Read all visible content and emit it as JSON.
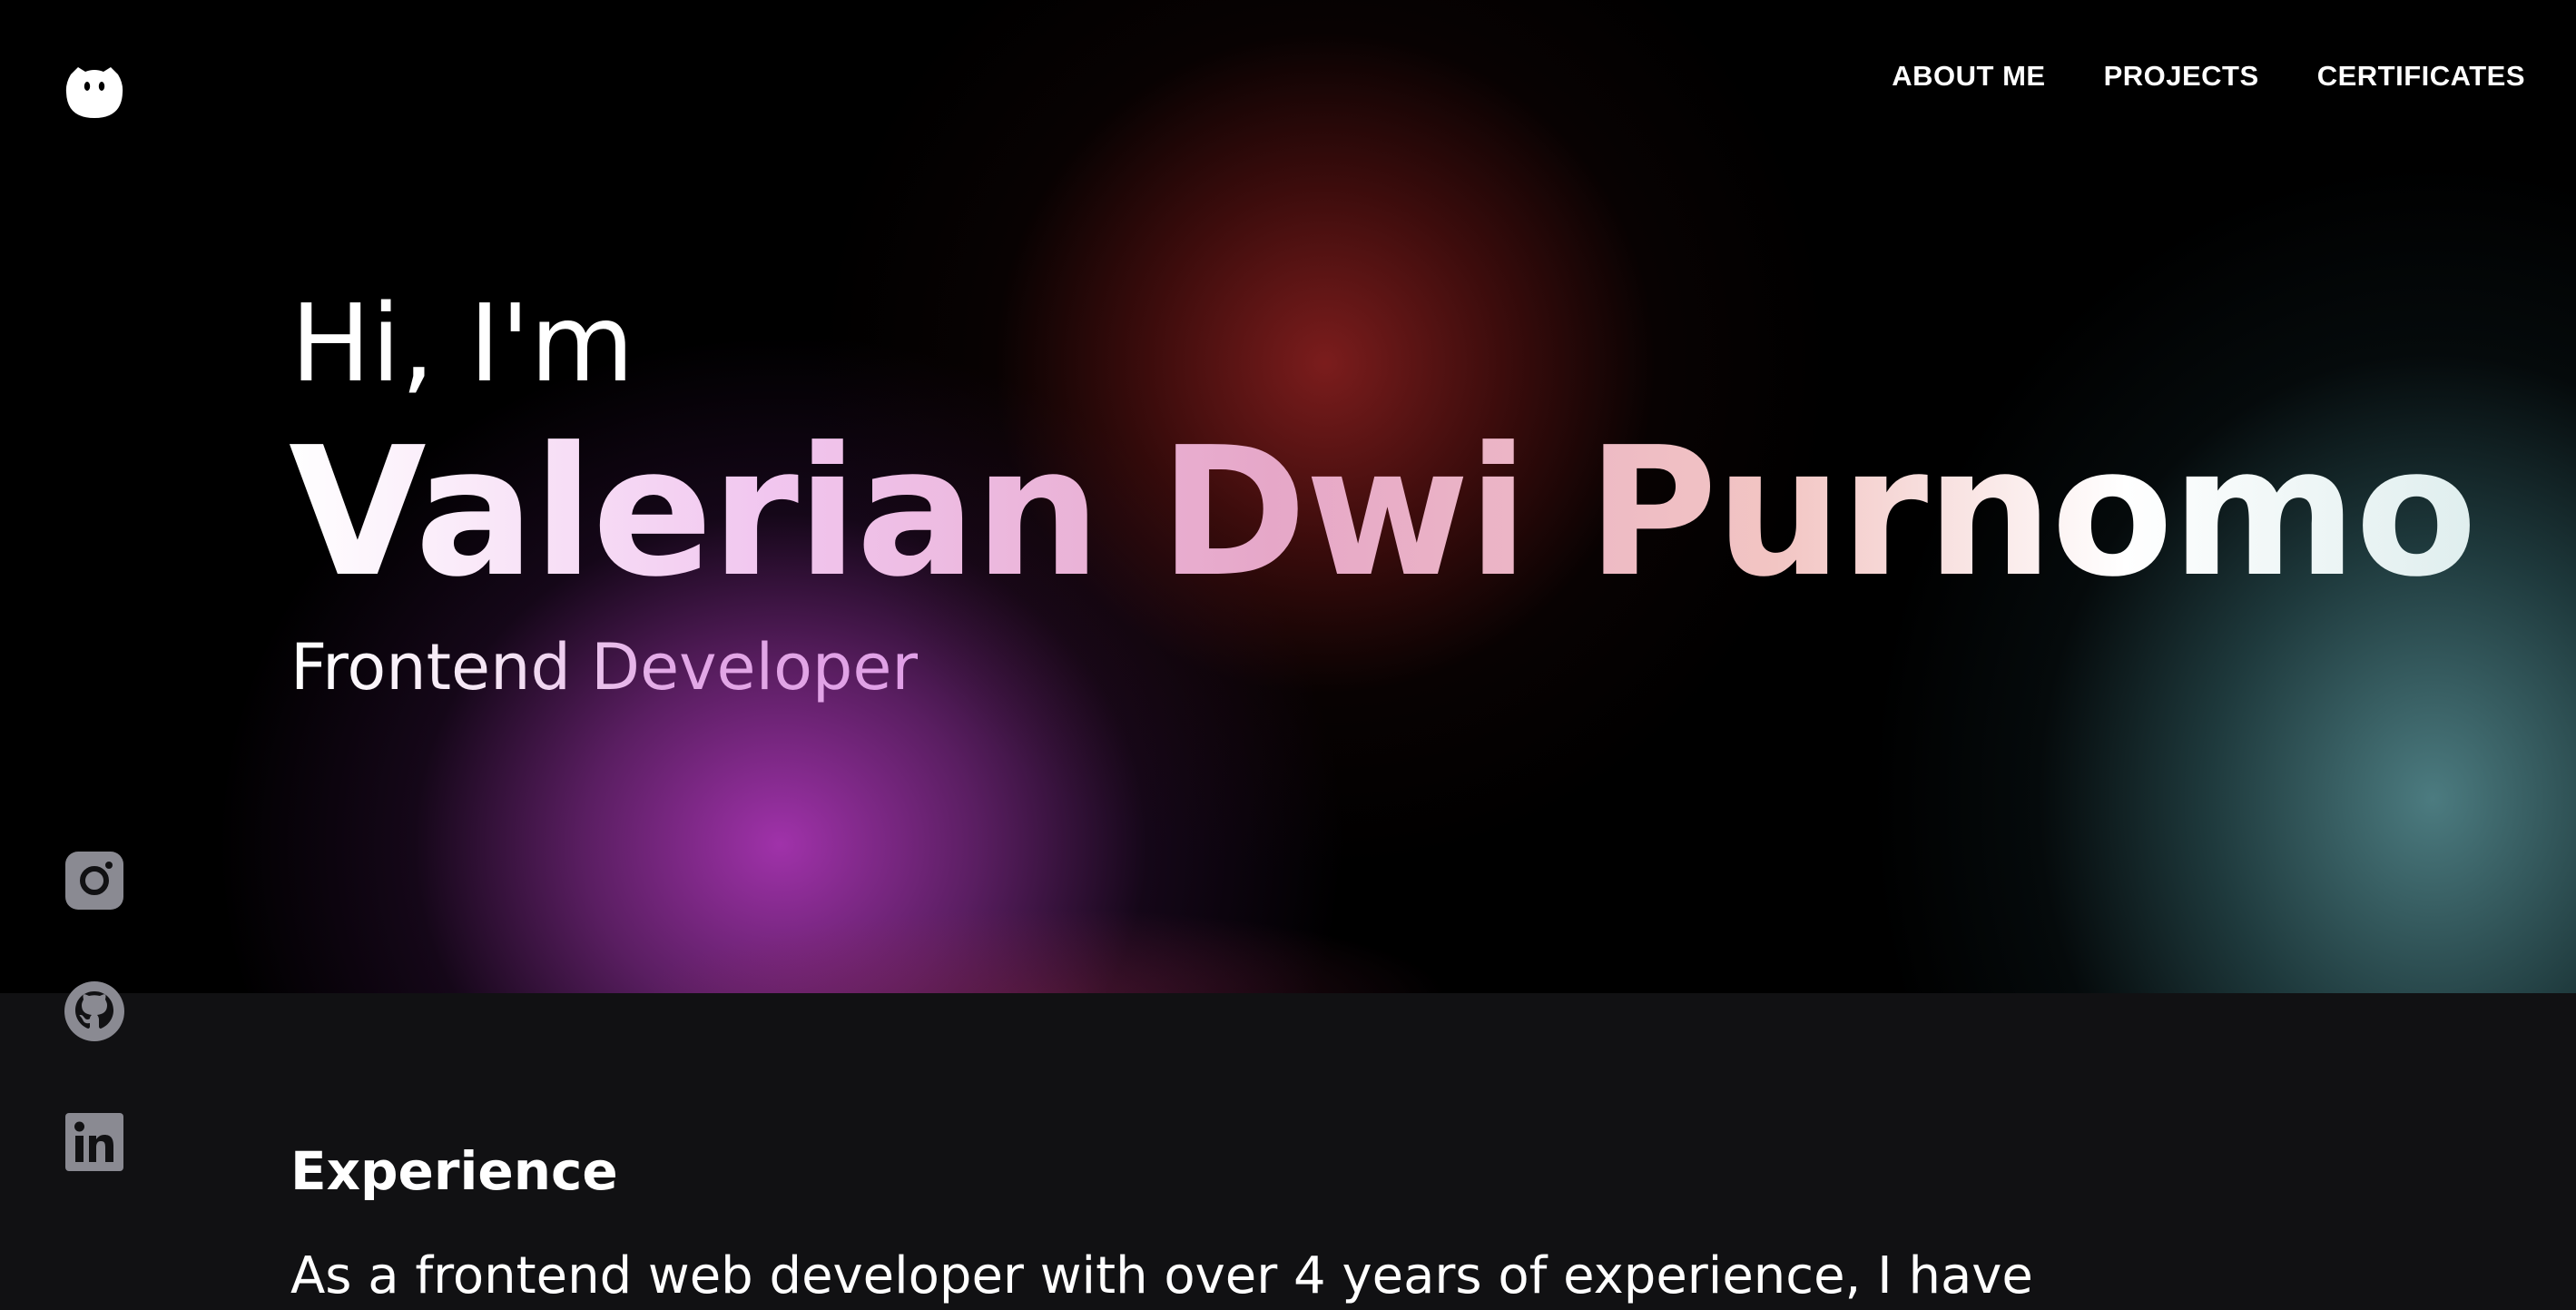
{
  "nav": {
    "items": [
      {
        "label": "ABOUT ME"
      },
      {
        "label": "PROJECTS"
      },
      {
        "label": "CERTIFICATES"
      }
    ]
  },
  "hero": {
    "greeting": "Hi, I'm",
    "name": "Valerian Dwi Purnomo",
    "role": "Frontend Developer"
  },
  "socials": [
    {
      "icon": "instagram-icon"
    },
    {
      "icon": "github-icon"
    },
    {
      "icon": "linkedin-icon"
    }
  ],
  "experience": {
    "title": "Experience",
    "body": "As a frontend web developer with over 4 years of experience, I have"
  },
  "colors": {
    "background": "#000000",
    "section_background": "#111113",
    "text": "#ffffff",
    "icon_gray": "#8a8a92"
  }
}
